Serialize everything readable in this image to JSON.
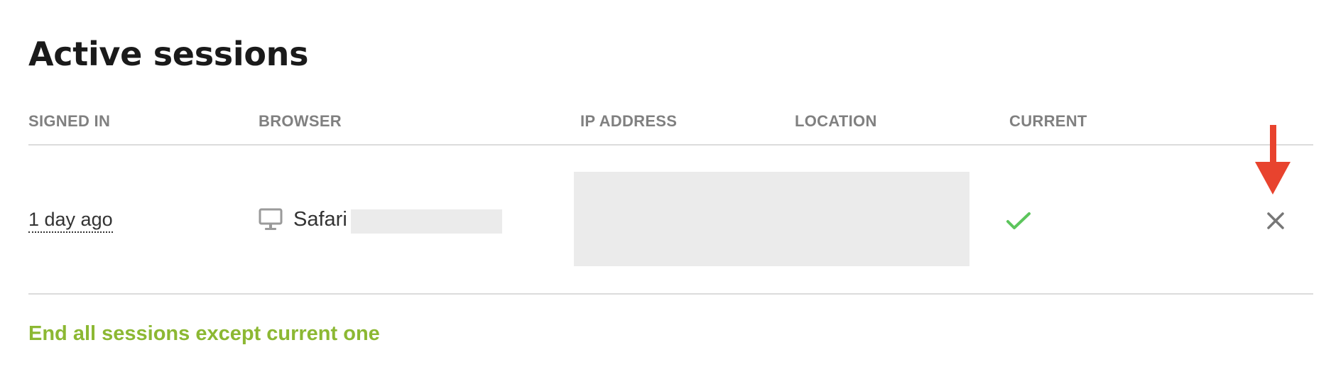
{
  "page": {
    "title": "Active sessions"
  },
  "table": {
    "columns": [
      "SIGNED IN",
      "BROWSER",
      "IP ADDRESS",
      "LOCATION",
      "CURRENT"
    ],
    "rows": [
      {
        "signed_in": "1 day ago",
        "browser": "Safari",
        "device_icon": "monitor-icon",
        "current": true,
        "current_icon": "checkmark-icon",
        "action_icon": "close-icon"
      }
    ]
  },
  "actions": {
    "end_all_label": "End all sessions except current one"
  },
  "colors": {
    "accent_link": "#8cb833",
    "check": "#5cc55c",
    "arrow": "#e8432e",
    "header_text": "#808080",
    "redaction": "#ebebeb"
  }
}
